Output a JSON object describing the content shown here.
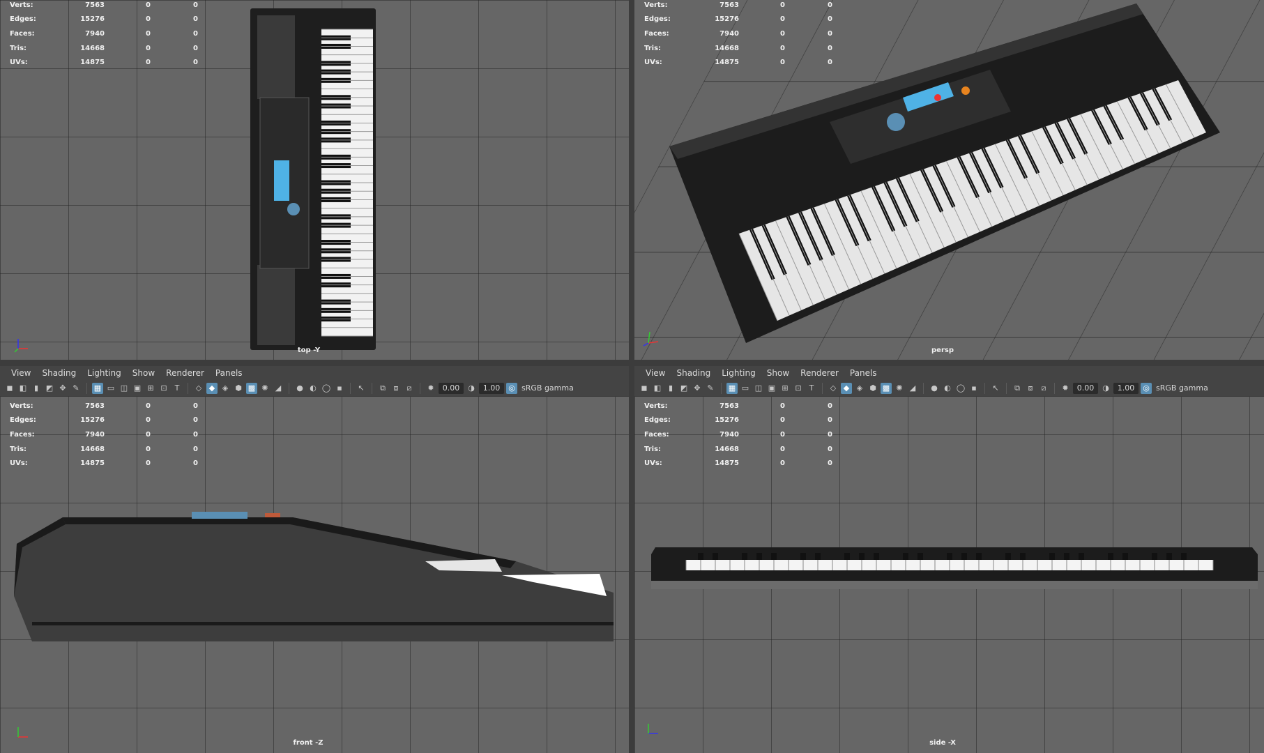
{
  "menus": [
    "View",
    "Shading",
    "Lighting",
    "Show",
    "Renderer",
    "Panels"
  ],
  "toolbar": {
    "exposure": "0.00",
    "gamma": "1.00",
    "color_space": "sRGB gamma"
  },
  "hud": {
    "rows": [
      {
        "label": "Verts:",
        "v1": "7563",
        "v2": "0",
        "v3": "0"
      },
      {
        "label": "Edges:",
        "v1": "15276",
        "v2": "0",
        "v3": "0"
      },
      {
        "label": "Faces:",
        "v1": "7940",
        "v2": "0",
        "v3": "0"
      },
      {
        "label": "Tris:",
        "v1": "14668",
        "v2": "0",
        "v3": "0"
      },
      {
        "label": "UVs:",
        "v1": "14875",
        "v2": "0",
        "v3": "0"
      }
    ]
  },
  "viewports": {
    "top": {
      "camera": "top -Y"
    },
    "persp": {
      "camera": "persp"
    },
    "front": {
      "camera": "front -Z"
    },
    "side": {
      "camera": "side -X"
    }
  },
  "colors": {
    "viewport_bg": "#666666",
    "panel_bg": "#444444",
    "active_icon": "#5a8fb4",
    "lcd": "#4fb2e6"
  },
  "icons": [
    "camera-icon",
    "grid-icon",
    "wireframe-icon",
    "shaded-icon",
    "light-icon",
    "exposure-icon",
    "gamma-icon",
    "color-space-icon"
  ]
}
